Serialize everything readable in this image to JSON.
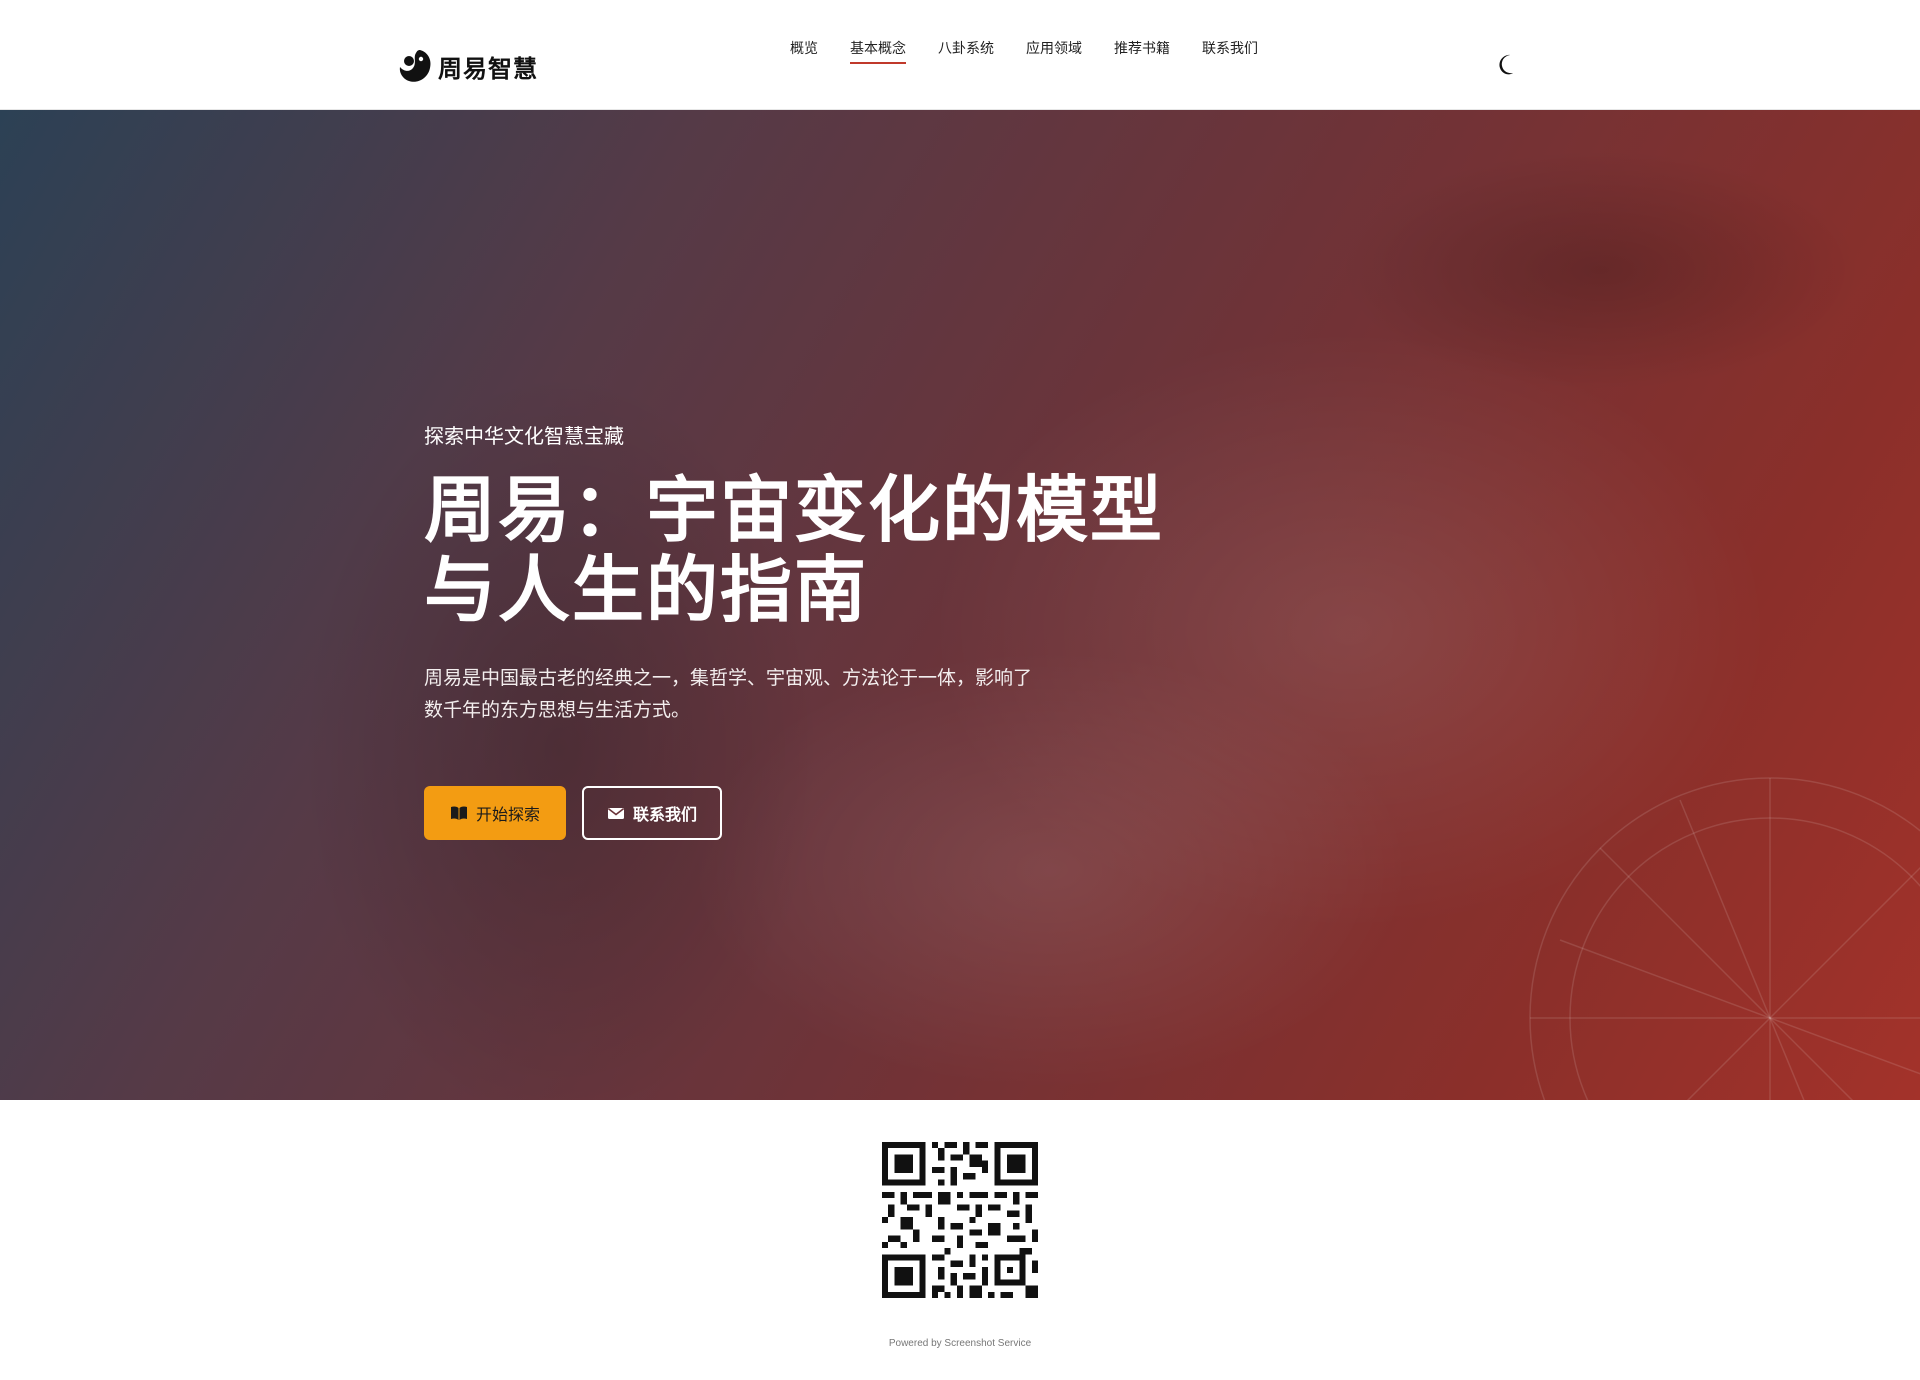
{
  "brand": {
    "name": "周易智慧",
    "logo_icon": "yin-yang-swirl-icon"
  },
  "nav": {
    "items": [
      {
        "label": "概览",
        "active": false
      },
      {
        "label": "基本概念",
        "active": true
      },
      {
        "label": "八卦系统",
        "active": false
      },
      {
        "label": "应用领域",
        "active": false
      },
      {
        "label": "推荐书籍",
        "active": false
      },
      {
        "label": "联系我们",
        "active": false
      }
    ],
    "active_color": "#c0392b",
    "theme_toggle_icon": "moon-icon"
  },
  "hero": {
    "eyebrow": "探索中华文化智慧宝藏",
    "title_line1": "周易：宇宙变化的模型",
    "title_line2": "与人生的指南",
    "description": "周易是中国最古老的经典之一，集哲学、宇宙观、方法论于一体，影响了数千年的东方思想与生活方式。",
    "primary_button": {
      "label": "开始探索",
      "icon": "book-icon",
      "color": "#f39c12"
    },
    "secondary_button": {
      "label": "联系我们",
      "icon": "envelope-icon"
    },
    "gradient_colors": [
      "#2c4155",
      "#553a47",
      "#6e3338",
      "#8b2f2a",
      "#a3322a"
    ]
  },
  "footer": {
    "qr_icon": "qr-code-icon",
    "powered_by": "Powered by Screenshot Service"
  }
}
